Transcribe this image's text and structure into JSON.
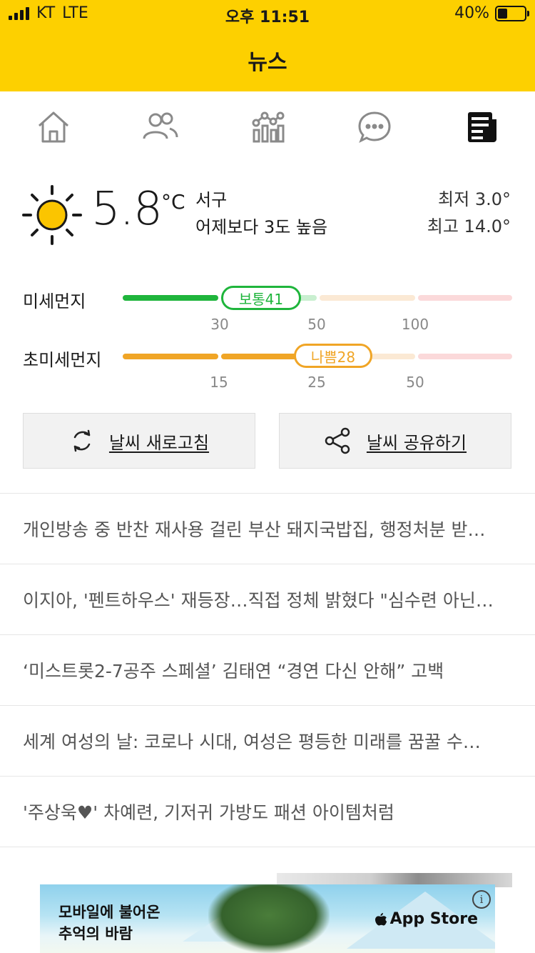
{
  "status_bar": {
    "carrier": "KT",
    "network": "LTE",
    "time": "오후 11:51",
    "battery": "40%",
    "battery_level": 0.4
  },
  "header": {
    "title": "뉴스"
  },
  "tabs": [
    {
      "name": "home-icon"
    },
    {
      "name": "people-icon"
    },
    {
      "name": "chart-icon"
    },
    {
      "name": "chat-icon"
    },
    {
      "name": "newspaper-icon",
      "active": true
    }
  ],
  "weather": {
    "icon": "sun-icon",
    "temperature": "5.8",
    "unit": "°C",
    "location": "서구",
    "comparison": "어제보다 3도 높음",
    "low": "최저 3.0°",
    "high": "최고 14.0°"
  },
  "dust": {
    "fine": {
      "label": "미세먼지",
      "badge": "보통41",
      "value": 41,
      "ticks": [
        "30",
        "50",
        "100"
      ],
      "color": "#1fb53c"
    },
    "ultrafine": {
      "label": "초미세먼지",
      "badge": "나쁨28",
      "value": 28,
      "ticks": [
        "15",
        "25",
        "50"
      ],
      "color": "#f0a526"
    }
  },
  "buttons": {
    "refresh": "날씨 새로고침",
    "share": "날씨 공유하기"
  },
  "news": [
    "개인방송 중 반찬 재사용 걸린 부산 돼지국밥집, 행정처분 받…",
    "이지아, '펜트하우스' 재등장…직접 정체 밝혔다 \"심수련 아닌…",
    "‘미스트롯2-7공주 스페셜’ 김태연 “경연 다신 안해” 고백",
    "세계 여성의 날: 코로나 시대, 여성은 평등한 미래를 꿈꿀 수…",
    "'주상욱♥' 차예련, 기저귀 가방도 패션 아이템처럼"
  ],
  "ad": {
    "line1": "모바일에 불어온",
    "line2": "추억의 바람",
    "store": "App Store",
    "info": "i"
  },
  "colors": {
    "accent": "#fdd000"
  }
}
